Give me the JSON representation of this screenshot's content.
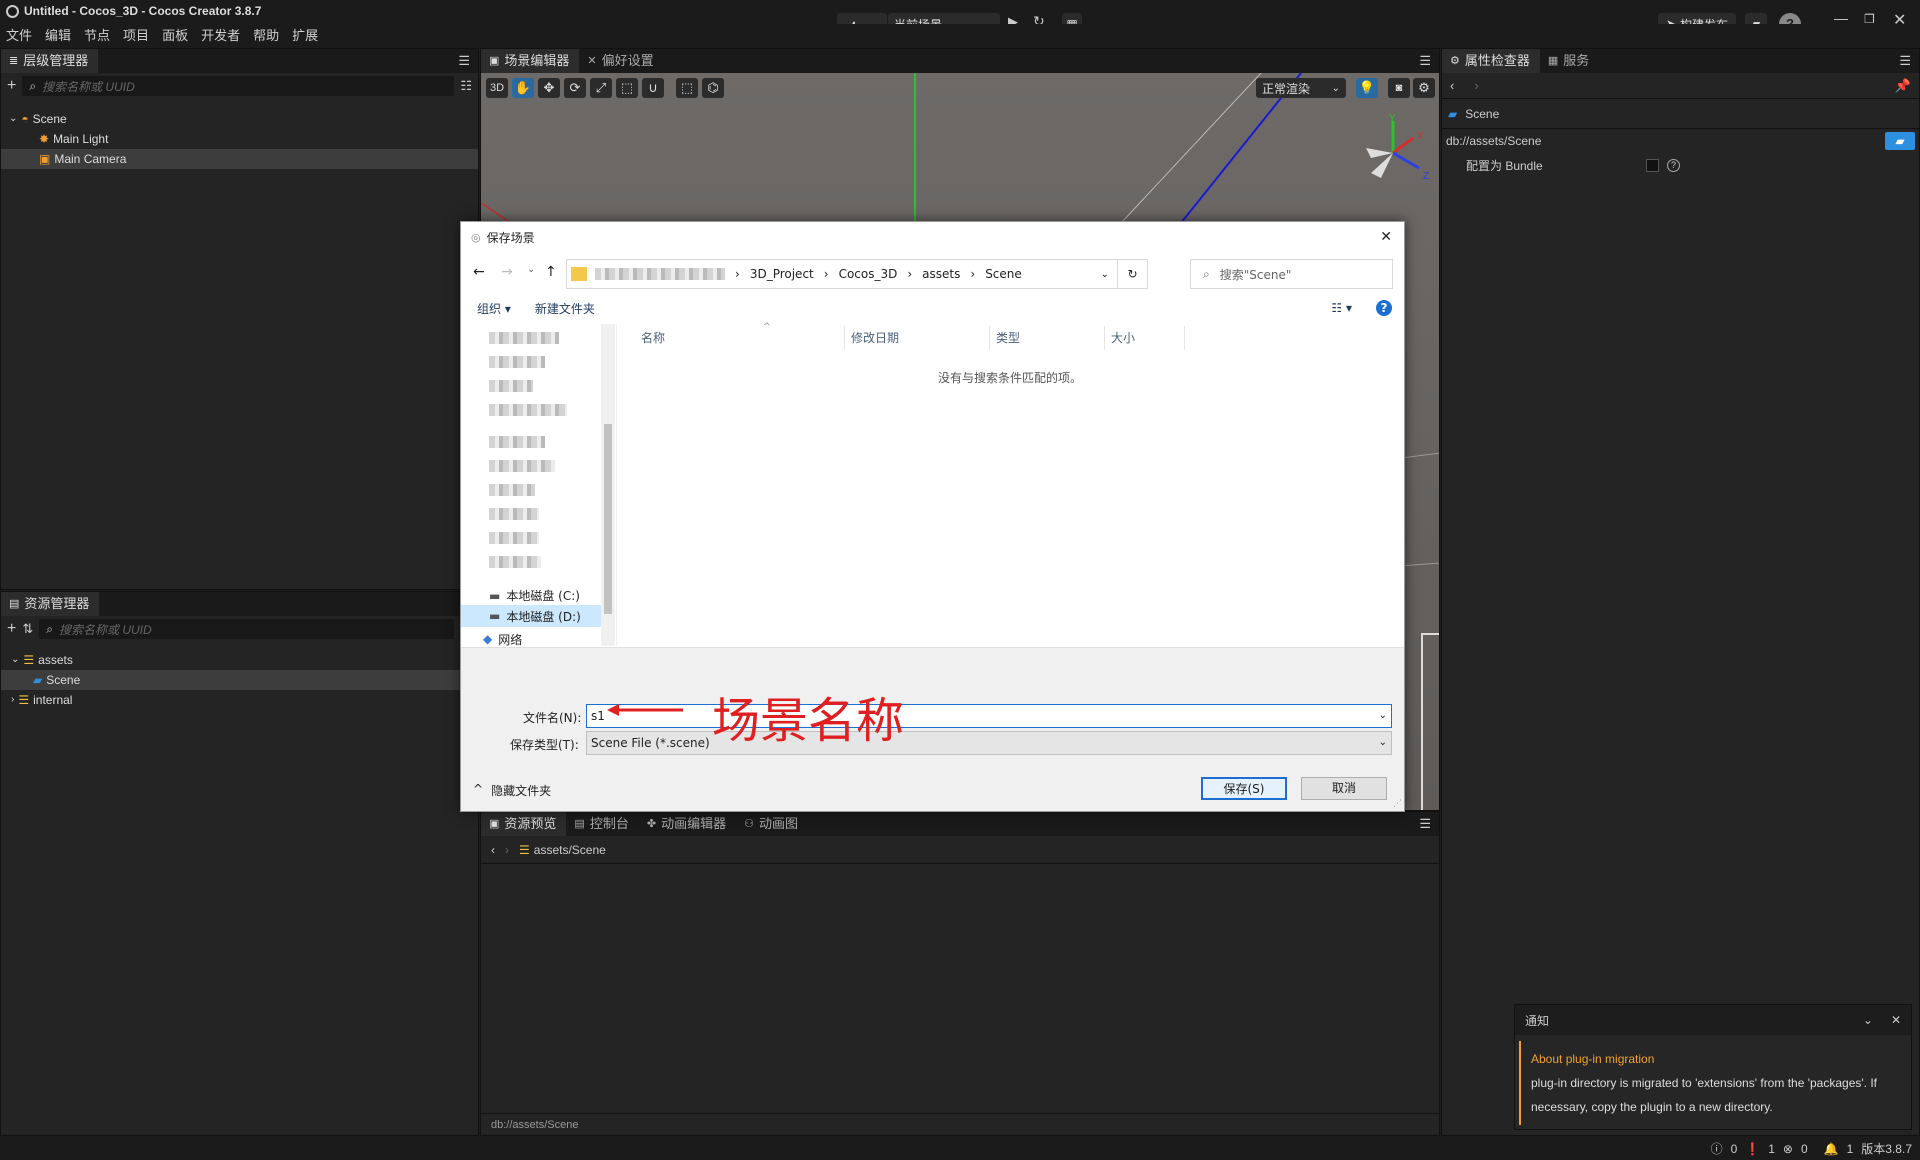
{
  "window": {
    "title": "Untitled - Cocos_3D - Cocos Creator 3.8.7"
  },
  "menu": [
    "文件",
    "编辑",
    "节点",
    "项目",
    "面板",
    "开发者",
    "帮助",
    "扩展"
  ],
  "toolbar": {
    "scene_select": "当前场景",
    "build_publish": "构建发布"
  },
  "hierarchy": {
    "tab": "层级管理器",
    "search_placeholder": "搜索名称或 UUID",
    "items": [
      {
        "label": "Scene",
        "icon": "scene-icon"
      },
      {
        "label": "Main Light",
        "icon": "light-icon"
      },
      {
        "label": "Main Camera",
        "icon": "camera-icon"
      }
    ]
  },
  "scene_editor": {
    "tabs": [
      "场景编辑器",
      "偏好设置"
    ],
    "mode_3d": "3D",
    "render_mode": "正常渲染",
    "gizmo": {
      "x": "X",
      "y": "Y",
      "z": "Z"
    }
  },
  "assets": {
    "tab": "资源管理器",
    "search_placeholder": "搜索名称或 UUID",
    "items": [
      {
        "label": "assets"
      },
      {
        "label": "Scene"
      },
      {
        "label": "internal"
      }
    ]
  },
  "inspector": {
    "tabs": [
      "属性检查器",
      "服务"
    ],
    "asset_name": "Scene",
    "path": "db://assets/Scene",
    "bundle_label": "配置为 Bundle"
  },
  "bottom_panel": {
    "tabs": [
      "资源预览",
      "控制台",
      "动画编辑器",
      "动画图"
    ],
    "breadcrumb": "assets/Scene",
    "status_path": "db://assets/Scene"
  },
  "notification": {
    "header": "通知",
    "title": "About plug-in migration",
    "body": "plug-in directory is migrated to 'extensions' from the 'packages'. If necessary, copy the plugin to a new directory.",
    "accent": "#f0a030"
  },
  "statusbar": {
    "info": "0",
    "warn": "1",
    "error": "0",
    "bell": "1",
    "version": "版本3.8.7"
  },
  "dialog": {
    "title": "保存场景",
    "breadcrumbs": [
      "3D_Project",
      "Cocos_3D",
      "assets",
      "Scene"
    ],
    "search_placeholder": "搜索\"Scene\"",
    "organize": "组织 ▾",
    "new_folder": "新建文件夹",
    "columns": [
      "名称",
      "修改日期",
      "类型",
      "大小"
    ],
    "empty_text": "没有与搜索条件匹配的项。",
    "nav_items": [
      "本地磁盘 (C:)",
      "本地磁盘 (D:)",
      "网络"
    ],
    "filename_label": "文件名(N):",
    "filename_value": "s1",
    "filetype_label": "保存类型(T):",
    "filetype_value": "Scene File (*.scene)",
    "hide_folders": "隐藏文件夹",
    "save": "保存(S)",
    "cancel": "取消"
  },
  "annotation": {
    "text": "场景名称",
    "color": "#e02020"
  }
}
